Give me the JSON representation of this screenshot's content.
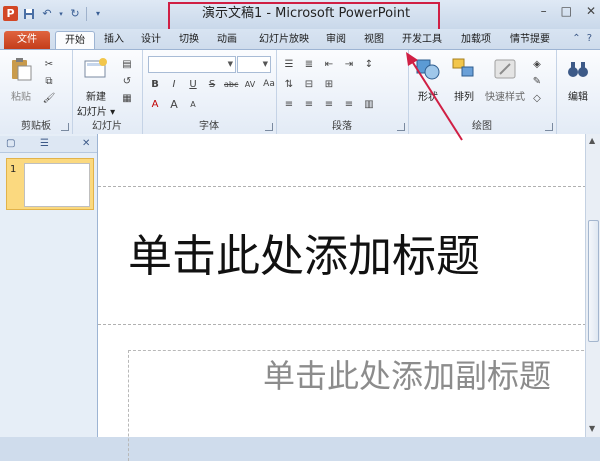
{
  "window": {
    "title": "演示文稿1 - Microsoft PowerPoint",
    "app_icon": "P",
    "controls": [
      "–",
      "□",
      "✕"
    ]
  },
  "tabs": {
    "file": "文件",
    "home": "开始",
    "insert": "插入",
    "design": "设计",
    "transitions": "切换",
    "animations": "动画",
    "slideshow": "幻灯片放映",
    "review": "审阅",
    "view": "视图",
    "developer": "开发工具",
    "addins": "加载项",
    "plot": "情节提要"
  },
  "ribbon": {
    "clipboard": {
      "paste": "粘贴",
      "label": "剪贴板"
    },
    "slides": {
      "new_slide_1": "新建",
      "new_slide_2": "幻灯片",
      "label": "幻灯片"
    },
    "font": {
      "label": "字体",
      "bold": "B",
      "italic": "I",
      "underline": "U",
      "strike": "S",
      "abc": "abc",
      "av": "AV",
      "aa": "Aa",
      "a_big": "A",
      "a_small": "A",
      "a_clear": "A"
    },
    "paragraph": {
      "label": "段落"
    },
    "drawing": {
      "shapes": "形状",
      "arrange": "排列",
      "quick_styles": "快速样式",
      "label": "绘图"
    },
    "editing": {
      "label": "编辑"
    }
  },
  "slide": {
    "title_placeholder": "单击此处添加标题",
    "subtitle_placeholder": "单击此处添加副标题"
  },
  "panel": {
    "slide_number": "1"
  },
  "colors": {
    "annotation": "#d01f44",
    "file_tab": "#d24726"
  }
}
